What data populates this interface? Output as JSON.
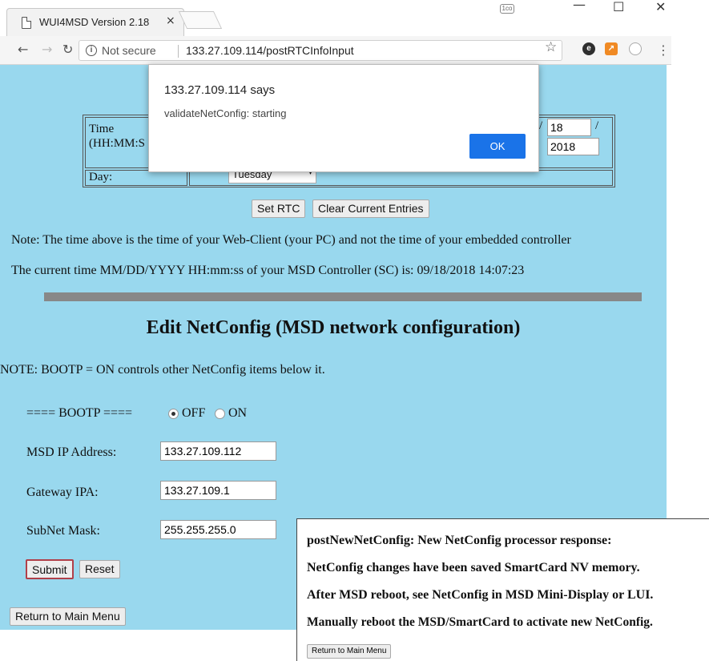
{
  "browser": {
    "tab_title": "WUI4MSD Version 2.18",
    "tab_close": "×",
    "not_secure": "Not secure",
    "url": "133.27.109.114/postRTCInfoInput",
    "win_min": "—",
    "win_max": "☐",
    "win_close": "✕"
  },
  "rtc": {
    "time_label_1": "Time",
    "time_label_2": "(HH:MM:S",
    "day_label": "Day:",
    "day_value": "Tuesday",
    "date_day": "18",
    "date_year": "2018",
    "slash": "/",
    "set_rtc": "Set RTC",
    "clear": "Clear Current Entries"
  },
  "notes": {
    "note1": "Note: The time above is the time of your Web-Client (your PC) and not the time of your embedded controller",
    "note2": "The current time MM/DD/YYYY HH:mm:ss of your MSD Controller (SC) is: 09/18/2018 14:07:23"
  },
  "netconfig": {
    "title": "Edit NetConfig (MSD network configuration)",
    "note": "NOTE: BOOTP = ON controls other NetConfig items below it.",
    "bootp_label": "==== BOOTP ====",
    "bootp_off": "OFF",
    "bootp_on": "ON",
    "bootp_selected": "OFF",
    "ip_label": "MSD IP Address:",
    "ip_value": "133.27.109.112",
    "gw_label": "Gateway IPA:",
    "gw_value": "133.27.109.1",
    "mask_label": "SubNet Mask:",
    "mask_value": "255.255.255.0",
    "submit": "Submit",
    "reset": "Reset",
    "return": "Return to Main Menu"
  },
  "dialog": {
    "title": "133.27.109.114 says",
    "message": "validateNetConfig: starting",
    "ok": "OK"
  },
  "response": {
    "line1": "postNewNetConfig: New NetConfig processor response:",
    "line2": "NetConfig changes have been saved SmartCard NV memory.",
    "line3": "After MSD reboot, see NetConfig in MSD Mini-Display or LUI.",
    "line4": "Manually reboot the MSD/SmartCard to activate new NetConfig.",
    "return": "Return to Main Menu"
  },
  "colors": {
    "page_bg": "#99d8ee",
    "ok_button": "#1a73e8",
    "divider": "#888888"
  }
}
